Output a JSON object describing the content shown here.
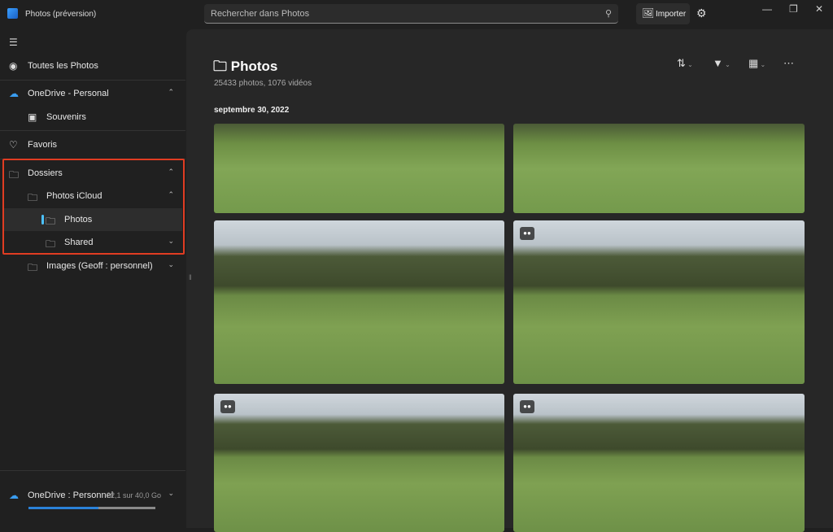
{
  "app": {
    "title": "Photos (préversion)"
  },
  "search": {
    "placeholder": "Rechercher dans Photos",
    "icon": "search-icon"
  },
  "header": {
    "import_label": "Importer"
  },
  "sidebar": {
    "all_photos": "Toutes les Photos",
    "onedrive": "OneDrive - Personal",
    "souvenirs": "Souvenirs",
    "favoris": "Favoris",
    "dossiers": "Dossiers",
    "icloud": "Photos iCloud",
    "photos": "Photos",
    "shared": "Shared",
    "images": "Images (Geoff : personnel)"
  },
  "storage": {
    "label": "OneDrive : Personnel",
    "usage": "22,1 sur 40,0 Go",
    "used_percent": 55,
    "bar_color": "#2b82d9"
  },
  "main": {
    "title": "Photos",
    "counts": "25433 photos, 1076 vidéos",
    "date_group": "septembre 30, 2022"
  },
  "colors": {
    "accent": "#4cc2ff",
    "highlight_box": "#e03c22"
  }
}
